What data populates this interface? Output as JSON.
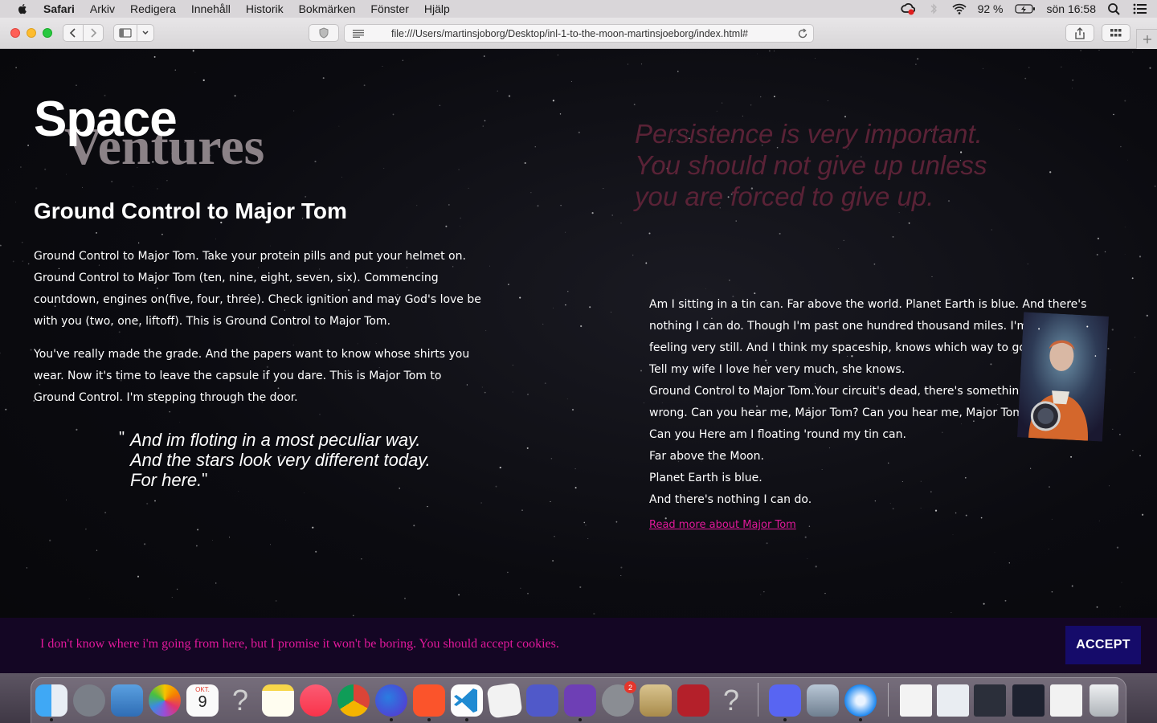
{
  "menubar": {
    "items": [
      "Safari",
      "Arkiv",
      "Redigera",
      "Innehåll",
      "Historik",
      "Bokmärken",
      "Fönster",
      "Hjälp"
    ],
    "battery": "92 %",
    "clock": "sön 16:58"
  },
  "toolbar": {
    "url": "file:///Users/martinsjoborg/Desktop/inl-1-to-the-moon-martinsjoeborg/index.html#"
  },
  "page": {
    "logo_top": "Space",
    "logo_bottom": "Ventures",
    "heading": "Ground Control to Major Tom",
    "paragraph1": "Ground Control to Major Tom. Take your protein pills and put your helmet on. Ground Control to Major Tom (ten, nine, eight, seven, six). Commencing countdown, engines on(five, four, three). Check ignition and may God's love be with you (two, one, liftoff). This is Ground Control to Major Tom.",
    "paragraph2": "You've really made the grade. And the papers want to know whose shirts you wear. Now it's time to leave the capsule if you dare. This is Major Tom to Ground Control. I'm stepping through the door.",
    "quote_lines": [
      "And im floting in a most peculiar way.",
      "And the stars look very different today.",
      "For here."
    ],
    "persistence_quote": "Persistence is very important. You should not give up unless you are forced to give up.",
    "right_lines": [
      "Am I sitting in a tin can. Far above the world. Planet Earth is blue. And there's",
      "nothing I can do. Though I'm past one hundred thousand miles. I'm",
      "feeling very still. And I think my spaceship, knows which way to go.",
      "Tell my wife I love her very much, she knows.",
      "Ground Control to Major Tom.Your circuit's dead, there's something",
      "wrong. Can you hear me, Major Tom? Can you hear me, Major Tom?",
      "Can you Here am I floating 'round my tin can.",
      "Far above the Moon.",
      "Planet Earth is blue.",
      "And there's nothing I can do."
    ],
    "read_more_link": "Read more about Major Tom"
  },
  "cookie": {
    "text": "I don't know where i'm going from here, but I promise it won't be boring. You should accept cookies.",
    "accept_label": "ACCEPT"
  },
  "dock": {
    "apps": [
      "finder",
      "launchpad",
      "preview",
      "photos",
      "calendar",
      "unknown-app",
      "notes",
      "music",
      "chrome",
      "firefox",
      "brave",
      "vscode",
      "textedit",
      "teams",
      "github-desktop",
      "system-preferences",
      "archive-utility",
      "photo-booth",
      "unknown-app",
      "discord",
      "image-capture",
      "safari",
      "documents",
      "window-1",
      "window-2",
      "window-3",
      "window-4",
      "trash"
    ],
    "calendar_month": "OKT.",
    "calendar_day": "9",
    "sysprefs_badge": "2"
  },
  "colors": {
    "accent_pink": "#e0189a",
    "accept_button": "#150b6a",
    "cookie_bg": "#140624",
    "persist_text": "#5a2236"
  }
}
